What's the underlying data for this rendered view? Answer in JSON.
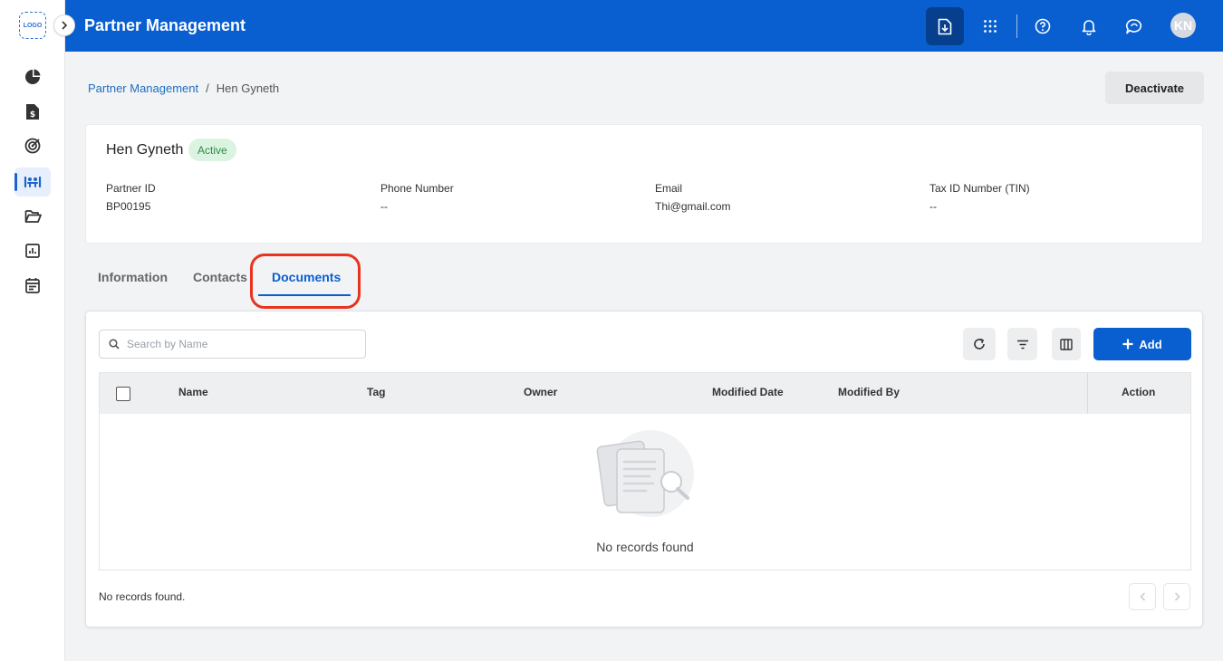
{
  "sidebar": {
    "logo_text": "LOGO",
    "items": [
      {
        "icon": "pie-chart-icon",
        "active": false
      },
      {
        "icon": "invoice-dollar-icon",
        "active": false
      },
      {
        "icon": "target-icon",
        "active": false
      },
      {
        "icon": "partners-icon",
        "active": true
      },
      {
        "icon": "folder-open-icon",
        "active": false
      },
      {
        "icon": "bar-chart-icon",
        "active": false
      },
      {
        "icon": "calendar-icon",
        "active": false
      }
    ]
  },
  "header": {
    "title": "Partner Management",
    "avatar_initials": "KN",
    "icons": [
      "download-icon",
      "apps-grid-icon",
      "help-icon",
      "bell-icon",
      "chat-icon"
    ]
  },
  "breadcrumb": {
    "parent": "Partner Management",
    "separator": "/",
    "current": "Hen Gyneth"
  },
  "actions": {
    "deactivate_label": "Deactivate"
  },
  "partner": {
    "name": "Hen Gyneth",
    "status": "Active",
    "fields": [
      {
        "label": "Partner ID",
        "value": "BP00195"
      },
      {
        "label": "Phone Number",
        "value": "--"
      },
      {
        "label": "Email",
        "value": "Thi@gmail.com"
      },
      {
        "label": "Tax ID Number (TIN)",
        "value": "--"
      }
    ]
  },
  "tabs": [
    {
      "label": "Information",
      "active": false
    },
    {
      "label": "Contacts",
      "active": false
    },
    {
      "label": "Documents",
      "active": true
    }
  ],
  "documents": {
    "search_placeholder": "Search by Name",
    "add_label": "Add",
    "columns": [
      "Name",
      "Tag",
      "Owner",
      "Modified Date",
      "Modified By",
      "Action"
    ],
    "empty_text": "No records found",
    "footer_text": "No records found."
  },
  "colors": {
    "primary": "#0a5fd0",
    "header_dark": "#073f8f",
    "status_bg": "#dbf4e1",
    "status_text": "#2e8b45",
    "highlight": "#e8331f"
  }
}
